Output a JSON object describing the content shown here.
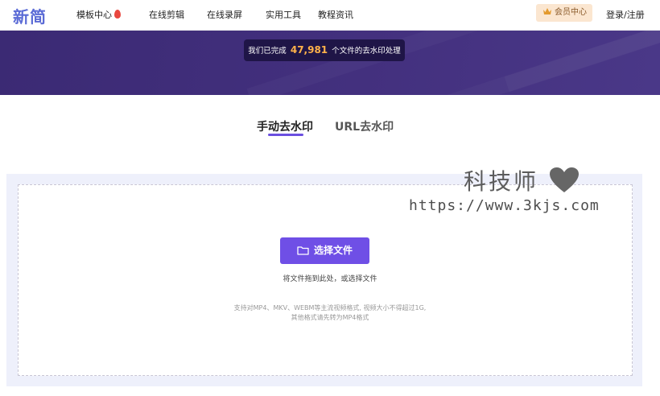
{
  "header": {
    "logo": "新简",
    "nav": [
      {
        "label": "模板中心",
        "hot": true
      },
      {
        "label": "在线剪辑"
      },
      {
        "label": "在线录屏"
      },
      {
        "label": "实用工具"
      },
      {
        "label": "教程资讯"
      }
    ],
    "vip_label": "会员中心",
    "login_label": "登录/注册"
  },
  "banner": {
    "counter_prefix": "我们已完成",
    "counter_value": "47,981",
    "counter_suffix": "个文件的去水印处理"
  },
  "tabs": [
    {
      "label": "手动去水印",
      "active": true
    },
    {
      "label": "URL去水印",
      "active": false
    }
  ],
  "upload": {
    "button_label": "选择文件",
    "drag_hint": "将文件拖到此处，或选择文件",
    "formats_line1": "支持对MP4、MKV、WEBM等主流视频格式, 视频大小不得超过1G,",
    "formats_line2": "其他格式请先转为MP4格式"
  },
  "watermark": {
    "title": "科技师",
    "url": "https://www.3kjs.com"
  },
  "colors": {
    "accent": "#6f4fe6",
    "banner": "#3f2c78",
    "counter_number": "#ffb24a"
  },
  "icons": [
    "flame-icon",
    "crown-icon",
    "folder-icon",
    "heart-icon"
  ]
}
